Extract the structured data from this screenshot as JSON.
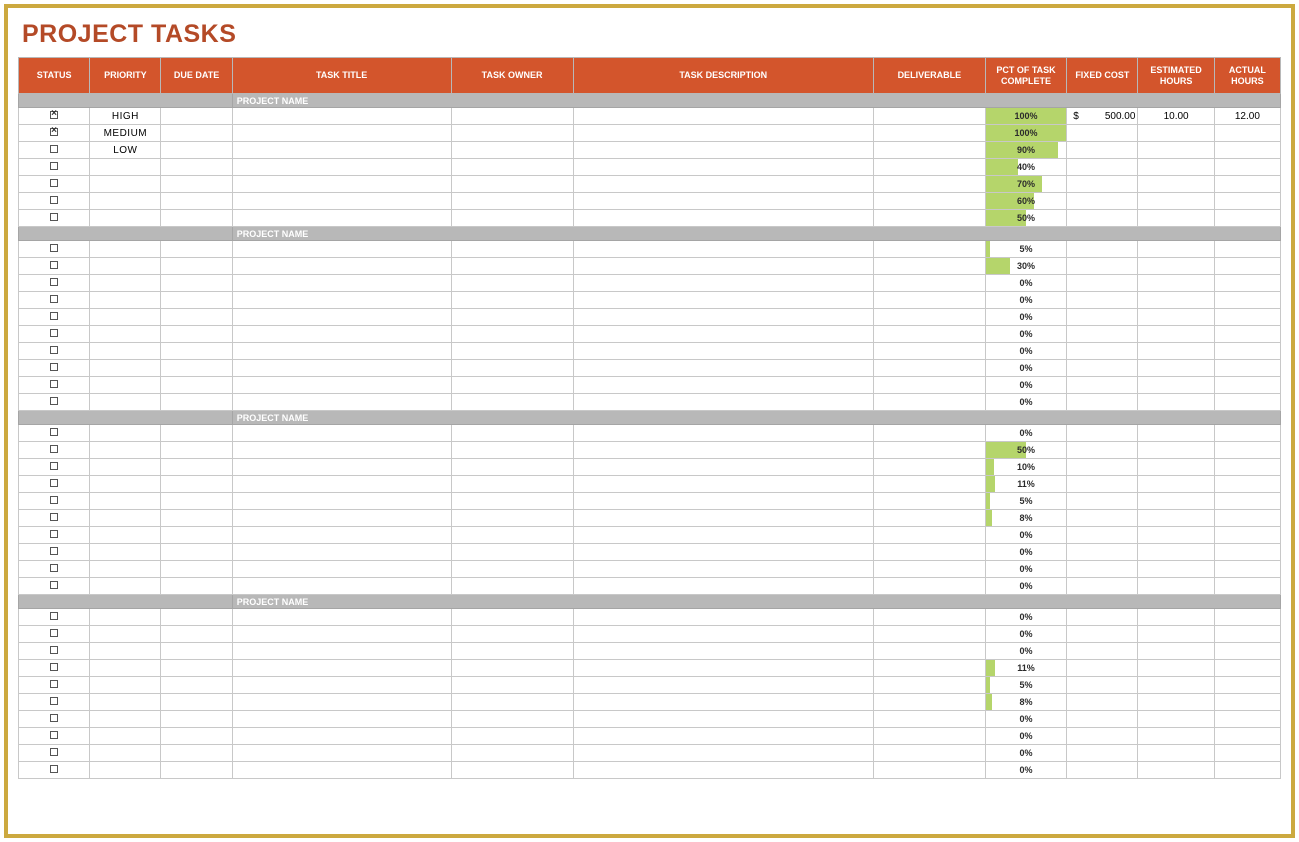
{
  "title": "PROJECT TASKS",
  "headers": {
    "status": "STATUS",
    "priority": "PRIORITY",
    "due_date": "DUE DATE",
    "task_title": "TASK TITLE",
    "task_owner": "TASK OWNER",
    "task_description": "TASK DESCRIPTION",
    "deliverable": "DELIVERABLE",
    "pct_complete": "PCT OF TASK COMPLETE",
    "fixed_cost": "FIXED COST",
    "est_hours": "ESTIMATED HOURS",
    "act_hours": "ACTUAL HOURS"
  },
  "section_label": "PROJECT NAME",
  "currency_symbol": "$",
  "sections": [
    {
      "rows": [
        {
          "checked": true,
          "priority": "HIGH",
          "pct": 100,
          "fixed_cost": "500.00",
          "est": "10.00",
          "act": "12.00"
        },
        {
          "checked": true,
          "priority": "MEDIUM",
          "pct": 100
        },
        {
          "checked": false,
          "priority": "LOW",
          "pct": 90
        },
        {
          "checked": false,
          "pct": 40
        },
        {
          "checked": false,
          "pct": 70
        },
        {
          "checked": false,
          "pct": 60
        },
        {
          "checked": false,
          "pct": 50
        }
      ]
    },
    {
      "rows": [
        {
          "checked": false,
          "pct": 5
        },
        {
          "checked": false,
          "pct": 30
        },
        {
          "checked": false,
          "pct": 0
        },
        {
          "checked": false,
          "pct": 0
        },
        {
          "checked": false,
          "pct": 0
        },
        {
          "checked": false,
          "pct": 0
        },
        {
          "checked": false,
          "pct": 0
        },
        {
          "checked": false,
          "pct": 0
        },
        {
          "checked": false,
          "pct": 0
        },
        {
          "checked": false,
          "pct": 0
        }
      ]
    },
    {
      "rows": [
        {
          "checked": false,
          "pct": 0
        },
        {
          "checked": false,
          "pct": 50
        },
        {
          "checked": false,
          "pct": 10
        },
        {
          "checked": false,
          "pct": 11
        },
        {
          "checked": false,
          "pct": 5
        },
        {
          "checked": false,
          "pct": 8
        },
        {
          "checked": false,
          "pct": 0
        },
        {
          "checked": false,
          "pct": 0
        },
        {
          "checked": false,
          "pct": 0
        },
        {
          "checked": false,
          "pct": 0
        }
      ]
    },
    {
      "rows": [
        {
          "checked": false,
          "pct": 0
        },
        {
          "checked": false,
          "pct": 0
        },
        {
          "checked": false,
          "pct": 0
        },
        {
          "checked": false,
          "pct": 11
        },
        {
          "checked": false,
          "pct": 5
        },
        {
          "checked": false,
          "pct": 8
        },
        {
          "checked": false,
          "pct": 0
        },
        {
          "checked": false,
          "pct": 0
        },
        {
          "checked": false,
          "pct": 0
        },
        {
          "checked": false,
          "pct": 0
        }
      ]
    }
  ]
}
